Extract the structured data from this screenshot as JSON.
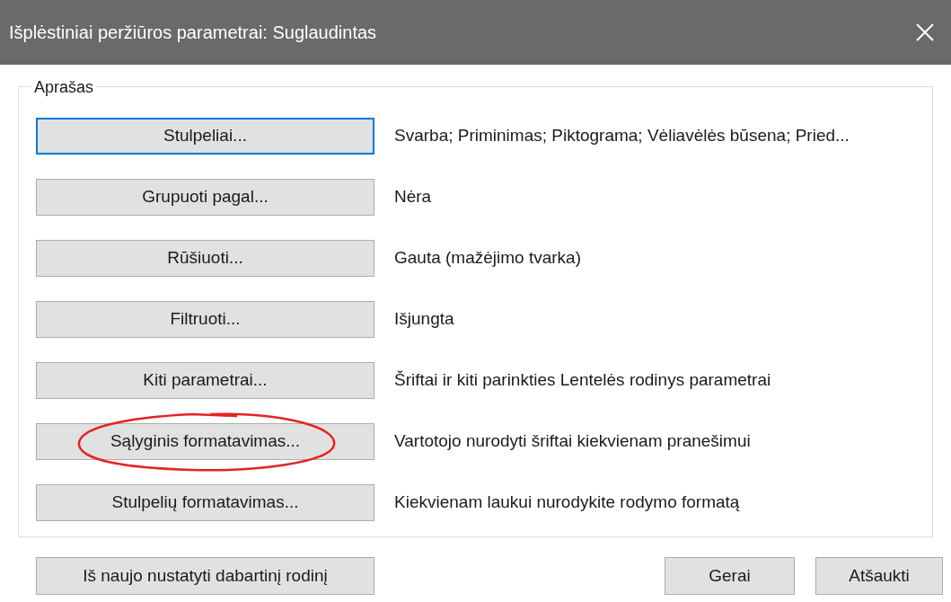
{
  "window": {
    "title": "Išplėstiniai peržiūros parametrai: Suglaudintas"
  },
  "group": {
    "legend": "Aprašas"
  },
  "rows": [
    {
      "button": "Stulpeliai...",
      "description": "Svarba; Priminimas; Piktograma; Vėliavėlės būsena; Pried...",
      "focused": true,
      "annotated": false
    },
    {
      "button": "Grupuoti pagal...",
      "description": "Nėra",
      "focused": false,
      "annotated": false
    },
    {
      "button": "Rūšiuoti...",
      "description": "Gauta (mažėjimo tvarka)",
      "focused": false,
      "annotated": false
    },
    {
      "button": "Filtruoti...",
      "description": "Išjungta",
      "focused": false,
      "annotated": false
    },
    {
      "button": "Kiti parametrai...",
      "description": "Šriftai ir kiti parinkties Lentelės rodinys parametrai",
      "focused": false,
      "annotated": false
    },
    {
      "button": "Sąlyginis formatavimas...",
      "description": "Vartotojo nurodyti šriftai kiekvienam pranešimui",
      "focused": false,
      "annotated": true
    },
    {
      "button": "Stulpelių formatavimas...",
      "description": "Kiekvienam laukui nurodykite rodymo formatą",
      "focused": false,
      "annotated": false
    }
  ],
  "footer": {
    "reset": "Iš naujo nustatyti dabartinį rodinį",
    "ok": "Gerai",
    "cancel": "Atšaukti"
  }
}
